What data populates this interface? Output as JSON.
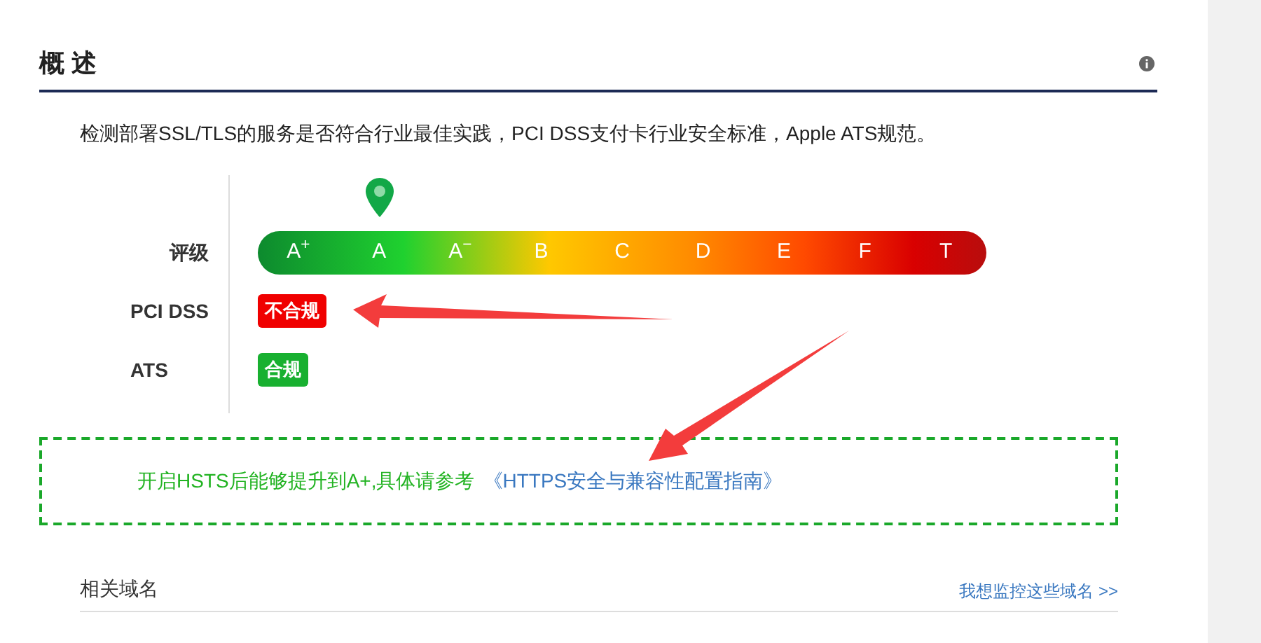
{
  "section": {
    "title": "概 述",
    "description": "检测部署SSL/TLS的服务是否符合行业最佳实践，PCI DSS支付卡行业安全标准，Apple ATS规范。"
  },
  "rating": {
    "label": "评级",
    "grades": [
      {
        "label": "A$^{+}$",
        "selected": false
      },
      {
        "label": "A",
        "selected": true
      },
      {
        "label": "A$^{−}$",
        "selected": false
      },
      {
        "label": "B",
        "selected": false
      },
      {
        "label": "C",
        "selected": false
      },
      {
        "label": "D",
        "selected": false
      },
      {
        "label": "E",
        "selected": false
      },
      {
        "label": "F",
        "selected": false
      },
      {
        "label": "T",
        "selected": false
      }
    ]
  },
  "compliance": [
    {
      "label": "PCI DSS",
      "status": "不合规",
      "kind": "fail"
    },
    {
      "label": "ATS",
      "status": "合规",
      "kind": "pass"
    }
  ],
  "tip": {
    "text": "开启HSTS后能够提升到A+,具体请参考",
    "link": "《HTTPS安全与兼容性配置指南》"
  },
  "related": {
    "title": "相关域名",
    "link": "我想监控这些域名 >>"
  }
}
